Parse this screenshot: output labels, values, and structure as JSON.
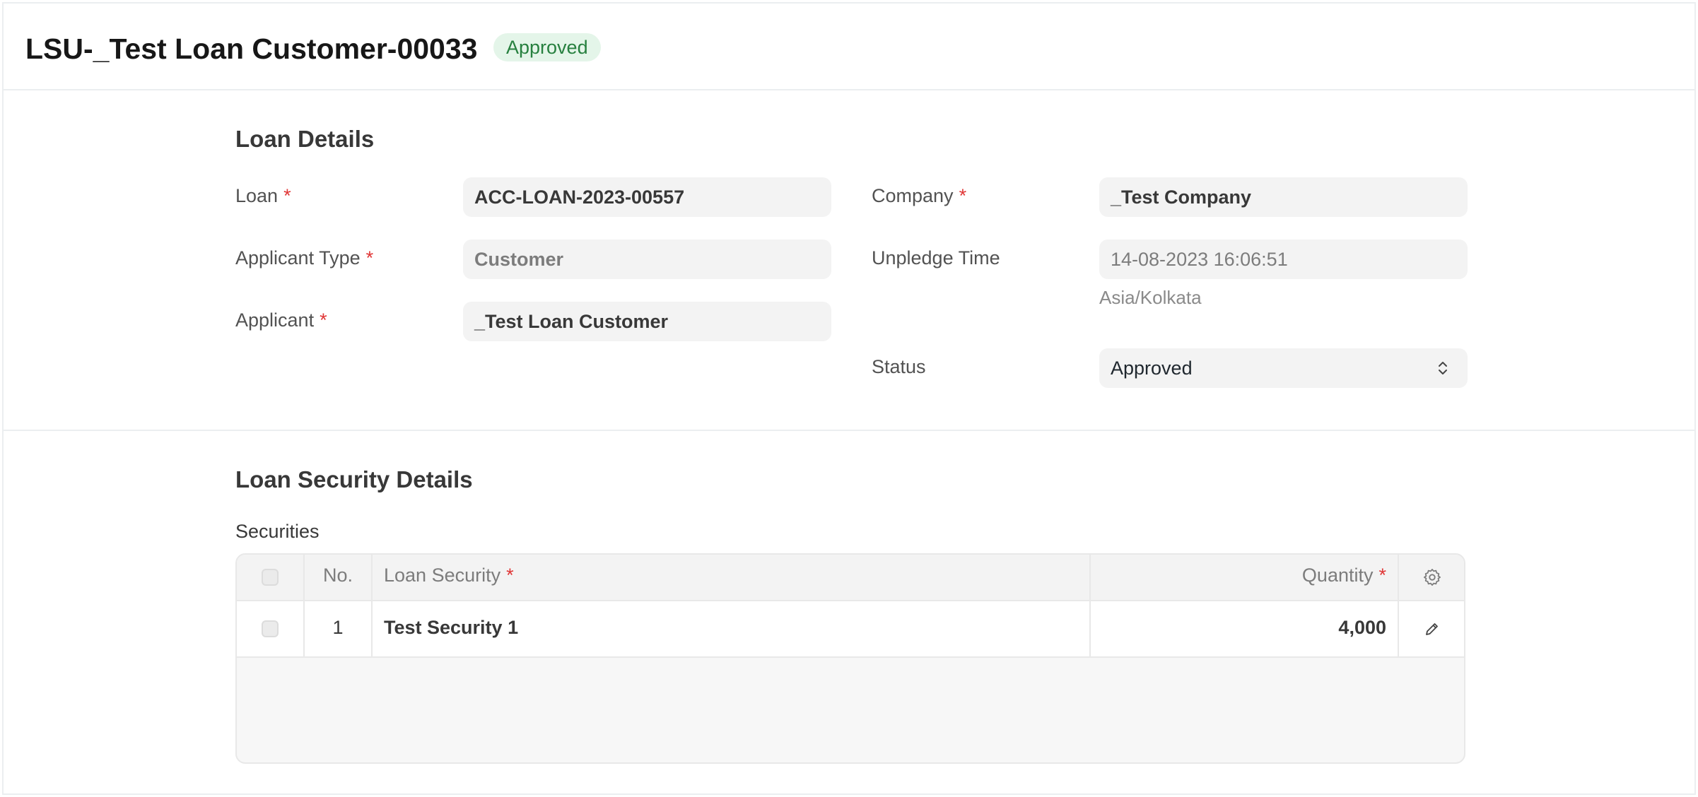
{
  "header": {
    "title": "LSU-_Test Loan Customer-00033",
    "status_badge": "Approved"
  },
  "loan_details": {
    "section_title": "Loan Details",
    "required_marker": "*",
    "loan": {
      "label": "Loan",
      "value": "ACC-LOAN-2023-00557"
    },
    "applicant_type": {
      "label": "Applicant Type",
      "value": "Customer"
    },
    "applicant": {
      "label": "Applicant",
      "value": "_Test Loan Customer"
    },
    "company": {
      "label": "Company",
      "value": "_Test Company"
    },
    "unpledge_time": {
      "label": "Unpledge Time",
      "value": "14-08-2023 16:06:51",
      "timezone": "Asia/Kolkata"
    },
    "status": {
      "label": "Status",
      "value": "Approved"
    }
  },
  "loan_security_details": {
    "section_title": "Loan Security Details",
    "table_label": "Securities",
    "columns": {
      "no": "No.",
      "loan_security": "Loan Security",
      "quantity": "Quantity"
    },
    "rows": [
      {
        "no": "1",
        "loan_security": "Test Security 1",
        "quantity": "4,000"
      }
    ]
  },
  "icons": {
    "settings": "gear-icon",
    "edit": "pencil-icon",
    "select": "chevron-updown-icon"
  },
  "colors": {
    "badge_bg": "#e4f5e9",
    "badge_text": "#27803f",
    "required": "#e03636"
  }
}
